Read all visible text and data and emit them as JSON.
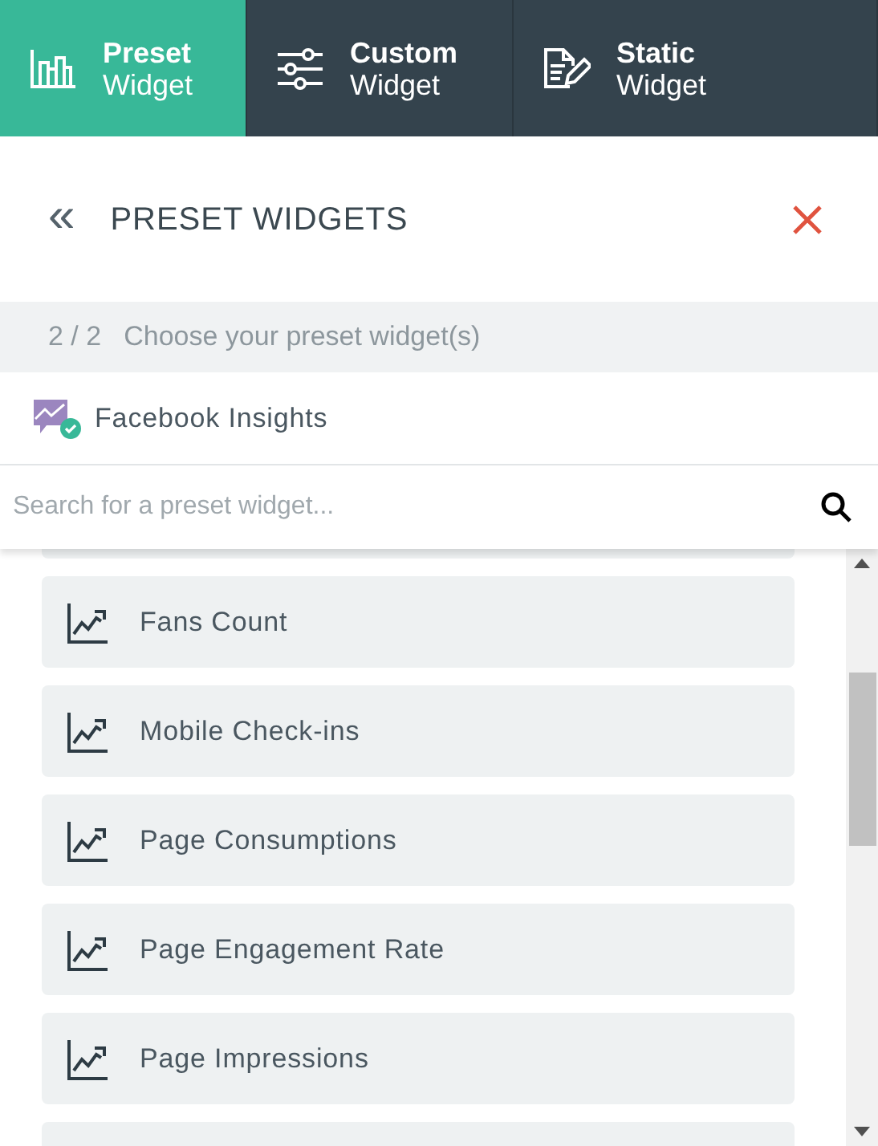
{
  "tabs": [
    {
      "title": "Preset",
      "subtitle": "Widget",
      "kind": "bars",
      "selected": true
    },
    {
      "title": "Custom",
      "subtitle": "Widget",
      "kind": "sliders",
      "selected": false
    },
    {
      "title": "Static",
      "subtitle": "Widget",
      "kind": "doc",
      "selected": false
    }
  ],
  "header": {
    "back": "«",
    "title": "PRESET WIDGETS"
  },
  "step": {
    "counter": "2 / 2",
    "label": "Choose your preset widget(s)"
  },
  "source": {
    "name": "Facebook Insights"
  },
  "search": {
    "placeholder": "Search for a preset widget..."
  },
  "widgets": [
    {
      "label": "Fans Count"
    },
    {
      "label": "Mobile Check-ins"
    },
    {
      "label": "Page Consumptions"
    },
    {
      "label": "Page Engagement Rate"
    },
    {
      "label": "Page Impressions"
    }
  ]
}
